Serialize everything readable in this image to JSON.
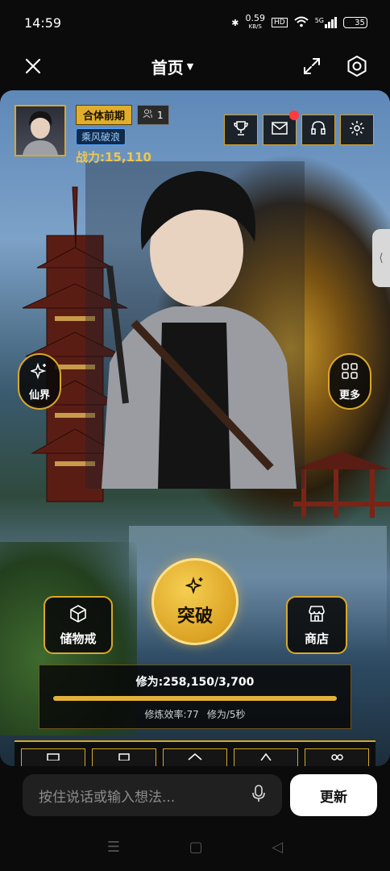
{
  "status_bar": {
    "time": "14:59",
    "speed": "0.59",
    "speed_unit": "KB/S",
    "hd": "HD",
    "network": "5G",
    "battery": "35"
  },
  "top_bar": {
    "title": "首页"
  },
  "player": {
    "realm": "合体前期",
    "friends_count": "1",
    "title_badge": "乘风破浪",
    "power": "战力:15,110"
  },
  "side_buttons": {
    "immortal_realm": "仙界",
    "more": "更多"
  },
  "actions": {
    "storage_ring": "储物戒",
    "shop": "商店",
    "breakthrough": "突破"
  },
  "cultivation": {
    "label": "修为:258,150/3,700",
    "efficiency": "修炼效率:77",
    "rate": "修为/5秒",
    "progress": 1.0
  },
  "chat": {
    "placeholder": "按住说话或输入想法...",
    "update_label": "更新"
  },
  "colors": {
    "gold": "#d9a72b",
    "accent": "#e3b23b",
    "badge_blue": "#4da3ff",
    "notification": "#ff3b3b"
  },
  "icons": [
    "close-icon",
    "chevron-down-icon",
    "expand-icon",
    "settings-hex-icon",
    "trophy-icon",
    "mail-icon",
    "headphones-icon",
    "gear-icon",
    "sparkle-icon",
    "grid-icon",
    "box-icon",
    "store-icon",
    "mic-icon",
    "friends-icon",
    "collapse-arrow-icon"
  ]
}
